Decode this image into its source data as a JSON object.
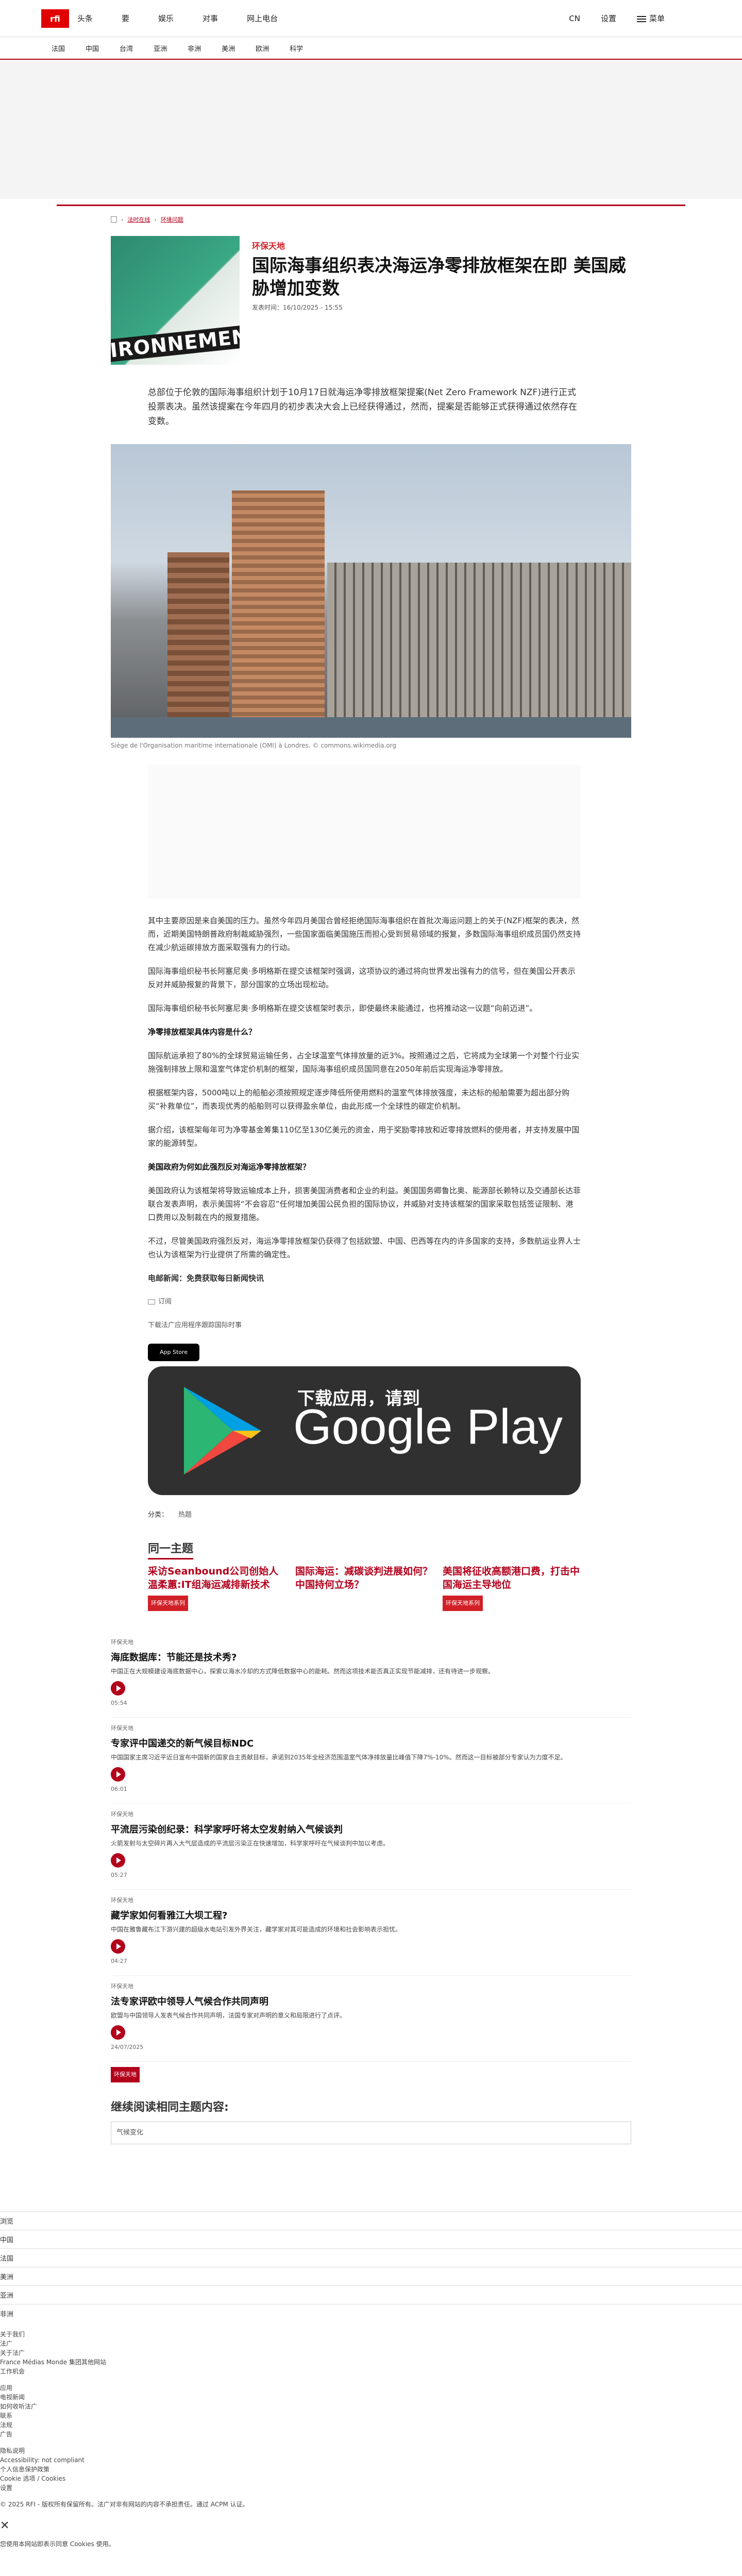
{
  "header": {
    "logo": "rfi",
    "nav": [
      "头条",
      "要",
      "娱乐",
      "对事",
      "网上电台"
    ],
    "lang": "CN",
    "settings": "设置",
    "menu": "菜单"
  },
  "sections": [
    "法国",
    "中国",
    "台湾",
    "亚洲",
    "非洲",
    "美洲",
    "欧洲",
    "科学"
  ],
  "breadcrumb": [
    "法时在线",
    "环境问题"
  ],
  "article": {
    "kicker": "环保天地",
    "title": "国际海事组织表决海运净零排放框架在即 美国威胁增加变数",
    "date": "发表时间：16/10/2025 - 15:55",
    "lead": "总部位于伦敦的国际海事组织计划于10月17日就海运净零排放框架提案(Net Zero Framework NZF)进行正式投票表决。虽然该提案在今年四月的初步表决大会上已经获得通过，然而，提案是否能够正式获得通过依然存在变数。",
    "thumb_label": "IRONNEMENT",
    "photo_caption": "Siège de l'Organisation maritime internationale (OMI) à Londres. © commons.wikimedia.org",
    "paragraphs": [
      "其中主要原因是来自美国的压力。虽然今年四月美国合曾经拒绝国际海事组织在首批次海运问题上的关于(NZF)框架的表决，然而，近期美国特朗普政府制裁威胁强烈，一些国家面临美国施压而担心受到贸易领域的报复，多数国际海事组织成员国仍然支持在减少航运碳排放方面采取强有力的行动。",
      "国际海事组织秘书长阿塞尼奥·多明格斯在提交该框架时强调，这项协议的通过将向世界发出强有力的信号，但在美国公开表示反对并威胁报复的背景下，部分国家的立场出现松动。",
      "国际海事组织秘书长阿塞尼奥·多明格斯在提交该框架时表示，即使最终未能通过，也将推动这一议题“向前迈进”。"
    ],
    "subhead1": "净零排放框架具体内容是什么？",
    "paragraphs2": [
      "国际航运承担了80%的全球贸易运输任务，占全球温室气体排放量的近3%。按照通过之后，它将成为全球第一个对整个行业实施强制排放上限和温室气体定价机制的框架，国际海事组织成员国同意在2050年前后实现海运净零排放。",
      "根据框架内容，5000吨以上的船舶必须按照规定逐步降低所使用燃料的温室气体排放强度，未达标的船舶需要为超出部分购买“补救单位”，而表现优秀的船舶则可以获得盈余单位，由此形成一个全球性的碳定价机制。",
      "据介绍，该框架每年可为净零基金筹集110亿至130亿美元的资金，用于奖励零排放和近零排放燃料的使用者，并支持发展中国家的能源转型。"
    ],
    "subhead2": "美国政府为何如此强烈反对海运净零排放框架？",
    "paragraphs3": [
      "美国政府认为该框架将导致运输成本上升，损害美国消费者和企业的利益。美国国务卿鲁比奥、能源部长赖特以及交通部长达菲联合发表声明，表示美国将“不会容忍”任何增加美国公民负担的国际协议，并威胁对支持该框架的国家采取包括签证限制、港口费用以及制裁在内的报复措施。",
      "不过，尽管美国政府强烈反对，海运净零排放框架仍获得了包括欧盟、中国、巴西等在内的许多国家的支持，多数航运业界人士也认为该框架为行业提供了所需的确定性。"
    ],
    "editor": "电邮新闻：免费获取每日新闻快讯",
    "editor_label": "电邮新闻",
    "subscribe": "订阅",
    "app_text": "下载法广应用程序跟踪国际时事",
    "app_store": "App Store",
    "gp_line1": "下载应用，请到",
    "gp_line2": "Google Play",
    "tags_label": "分类：",
    "tags": [
      "热题"
    ]
  },
  "same_topic": {
    "heading": "同一主题",
    "items": [
      {
        "title": "采访Seanbound公司创始人温柔蕙:IT组海运减排新技术",
        "cat": "环保天地系列"
      },
      {
        "title": "国际海运：减碳谈判进展如何？中国持何立场？",
        "cat": ""
      },
      {
        "title": "美国将征收高额港口费，打击中国海运主导地位",
        "cat": "环保天地系列"
      }
    ]
  },
  "news": [
    {
      "kicker": "环保天地",
      "title": "海底数据库：节能还是技术秀?",
      "desc": "中国正在大规模建设海底数据中心，探索以海水冷却的方式降低数据中心的能耗。然而这项技术能否真正实现节能减排，还有待进一步观察。",
      "time": "05:54"
    },
    {
      "kicker": "环保天地",
      "title": "专家评中国递交的新气候目标NDC",
      "desc": "中国国家主席习近平近日宣布中国新的国家自主贡献目标，承诺到2035年全经济范围温室气体净排放量比峰值下降7%-10%。然而这一目标被部分专家认为力度不足。",
      "time": "06:01"
    },
    {
      "kicker": "环保天地",
      "title": "平流层污染创纪录：科学家呼吁将太空发射纳入气候谈判",
      "desc": "火箭发射与太空碎片再入大气层造成的平流层污染正在快速增加，科学家呼吁在气候谈判中加以考虑。",
      "time": "05:27"
    },
    {
      "kicker": "环保天地",
      "title": "藏学家如何看雅江大坝工程?",
      "desc": "中国在雅鲁藏布江下游兴建的超级水电站引发外界关注，藏学家对其可能造成的环境和社会影响表示担忧。",
      "time": "04:27"
    },
    {
      "kicker": "环保天地",
      "title": "法专家评欧中领导人气候合作共同声明",
      "desc": "欧盟与中国领导人发表气候合作共同声明，法国专家对声明的意义和局限进行了点评。",
      "time": "24/07/2025"
    }
  ],
  "more_label": "环保天地",
  "continue": {
    "heading": "继续阅读相同主题内容:",
    "tag": "气候变化"
  },
  "footer": {
    "title": "浏览",
    "items": [
      "中国",
      "法国",
      "美洲",
      "亚洲",
      "非洲"
    ],
    "about_title": "关于我们",
    "about": [
      "法广",
      "关于法广",
      "France Médias Monde 集团其他网站",
      "工作机会"
    ],
    "apps_title": "应用",
    "apps": [
      "电视新闻",
      "如何收听法广"
    ],
    "links": [
      "联系",
      "法规",
      "广告"
    ],
    "legal_title": "隐私说明",
    "legal": [
      "Accessibility: not compliant",
      "个人信息保护政策",
      "Cookie 选项 / Cookies",
      "设置"
    ],
    "copyright": "© 2025 RFI - 版权所有保留所有。法广对非有网站的内容不承担责任。通过 ACPM 认证。",
    "bottom": "您使用本网站即表示同意 Cookies 使用。"
  }
}
